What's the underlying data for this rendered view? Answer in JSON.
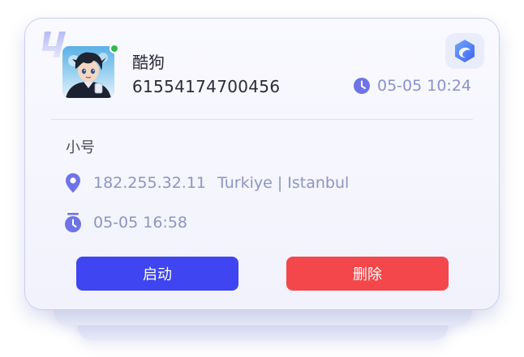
{
  "account": {
    "name": "酷狗",
    "id": "61554174700456",
    "last_time": "05-05 10:24",
    "tag": "小号"
  },
  "details": {
    "ip": "182.255.32.11",
    "location": "Turkiye | Istanbul",
    "date": "05-05 16:58"
  },
  "actions": {
    "start_label": "启动",
    "delete_label": "删除"
  },
  "colors": {
    "primary": "#3f45f0",
    "danger": "#f4474b",
    "accent_icon": "#6e74e6",
    "muted_text": "#8e95bf",
    "online": "#2fb94a"
  },
  "icons": {
    "corner": "hexagon-logo-icon",
    "time": "clock-icon",
    "location": "location-pin-icon",
    "date": "timer-icon",
    "online": "online-status-dot"
  }
}
